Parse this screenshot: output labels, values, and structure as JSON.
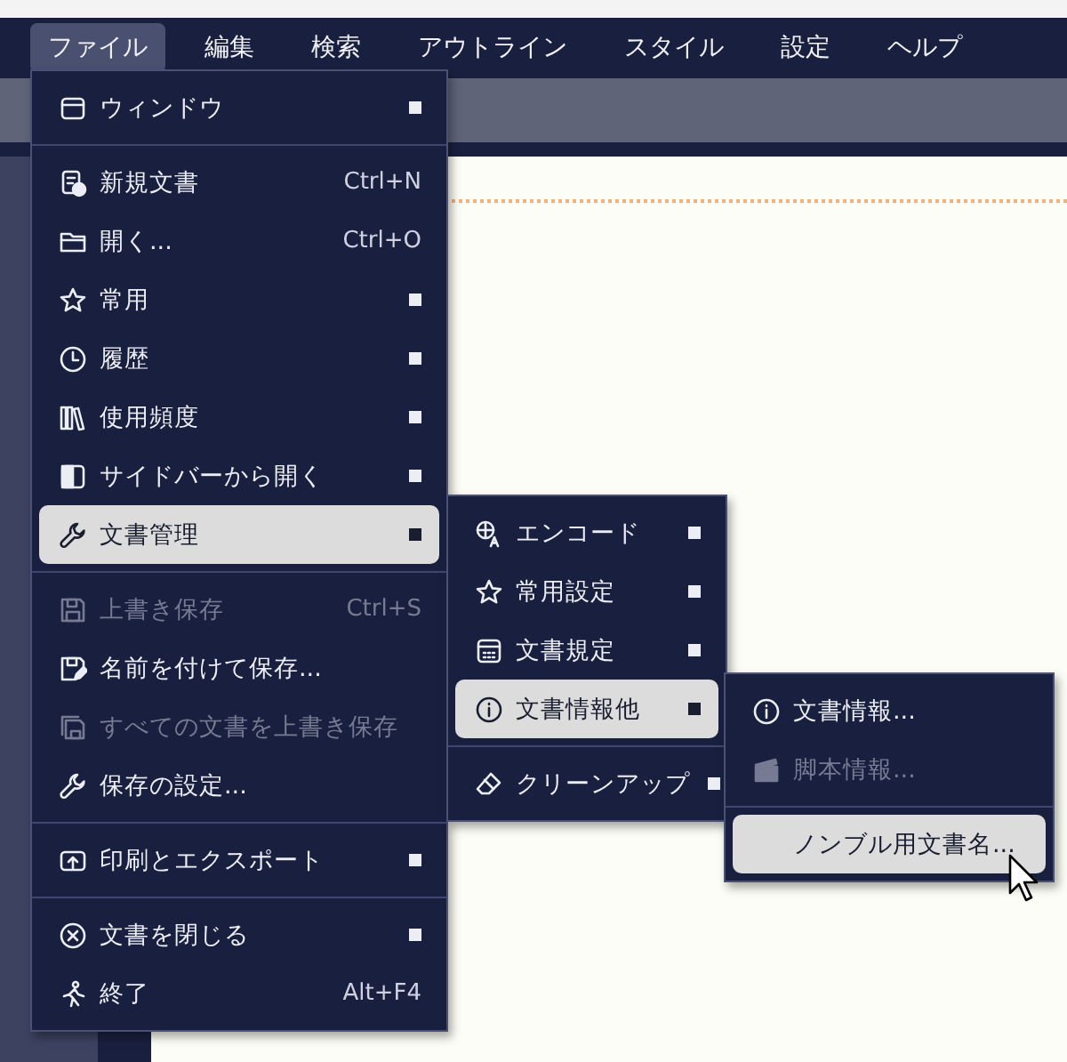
{
  "menubar": [
    {
      "label": "ファイル",
      "selected": true
    },
    {
      "label": "編集",
      "selected": false
    },
    {
      "label": "検索",
      "selected": false
    },
    {
      "label": "アウトライン",
      "selected": false
    },
    {
      "label": "スタイル",
      "selected": false
    },
    {
      "label": "設定",
      "selected": false
    },
    {
      "label": "ヘルプ",
      "selected": false
    }
  ],
  "file_menu": {
    "groups": [
      [
        {
          "label": "ウィンドウ",
          "has_submenu": true,
          "disabled": false,
          "selected": false
        }
      ],
      [
        {
          "label": "新規文書",
          "shortcut": "Ctrl+N",
          "has_submenu": false,
          "disabled": false,
          "selected": false
        },
        {
          "label": "開く...",
          "shortcut": "Ctrl+O",
          "has_submenu": false,
          "disabled": false,
          "selected": false
        },
        {
          "label": "常用",
          "has_submenu": true,
          "disabled": false,
          "selected": false
        },
        {
          "label": "履歴",
          "has_submenu": true,
          "disabled": false,
          "selected": false
        },
        {
          "label": "使用頻度",
          "has_submenu": true,
          "disabled": false,
          "selected": false
        },
        {
          "label": "サイドバーから開く",
          "has_submenu": true,
          "disabled": false,
          "selected": false
        },
        {
          "label": "文書管理",
          "has_submenu": true,
          "disabled": false,
          "selected": true
        }
      ],
      [
        {
          "label": "上書き保存",
          "shortcut": "Ctrl+S",
          "has_submenu": false,
          "disabled": true,
          "selected": false
        },
        {
          "label": "名前を付けて保存...",
          "has_submenu": false,
          "disabled": false,
          "selected": false
        },
        {
          "label": "すべての文書を上書き保存",
          "has_submenu": false,
          "disabled": true,
          "selected": false
        },
        {
          "label": "保存の設定...",
          "has_submenu": false,
          "disabled": false,
          "selected": false
        }
      ],
      [
        {
          "label": "印刷とエクスポート",
          "has_submenu": true,
          "disabled": false,
          "selected": false
        }
      ],
      [
        {
          "label": "文書を閉じる",
          "has_submenu": true,
          "disabled": false,
          "selected": false
        },
        {
          "label": "終了",
          "shortcut": "Alt+F4",
          "has_submenu": false,
          "disabled": false,
          "selected": false
        }
      ]
    ]
  },
  "document_menu": {
    "groups": [
      [
        {
          "label": "エンコード",
          "has_submenu": true,
          "disabled": false,
          "selected": false
        },
        {
          "label": "常用設定",
          "has_submenu": true,
          "disabled": false,
          "selected": false
        },
        {
          "label": "文書規定",
          "has_submenu": true,
          "disabled": false,
          "selected": false
        },
        {
          "label": "文書情報他",
          "has_submenu": true,
          "disabled": false,
          "selected": true
        }
      ],
      [
        {
          "label": "クリーンアップ",
          "has_submenu": true,
          "disabled": false,
          "selected": false
        }
      ]
    ]
  },
  "info_menu": {
    "groups": [
      [
        {
          "label": "文書情報...",
          "has_submenu": false,
          "disabled": false,
          "selected": false
        },
        {
          "label": "脚本情報...",
          "has_submenu": false,
          "disabled": true,
          "selected": false
        }
      ],
      [
        {
          "label": "ノンブル用文書名...",
          "has_submenu": false,
          "disabled": false,
          "selected": true
        }
      ]
    ]
  }
}
